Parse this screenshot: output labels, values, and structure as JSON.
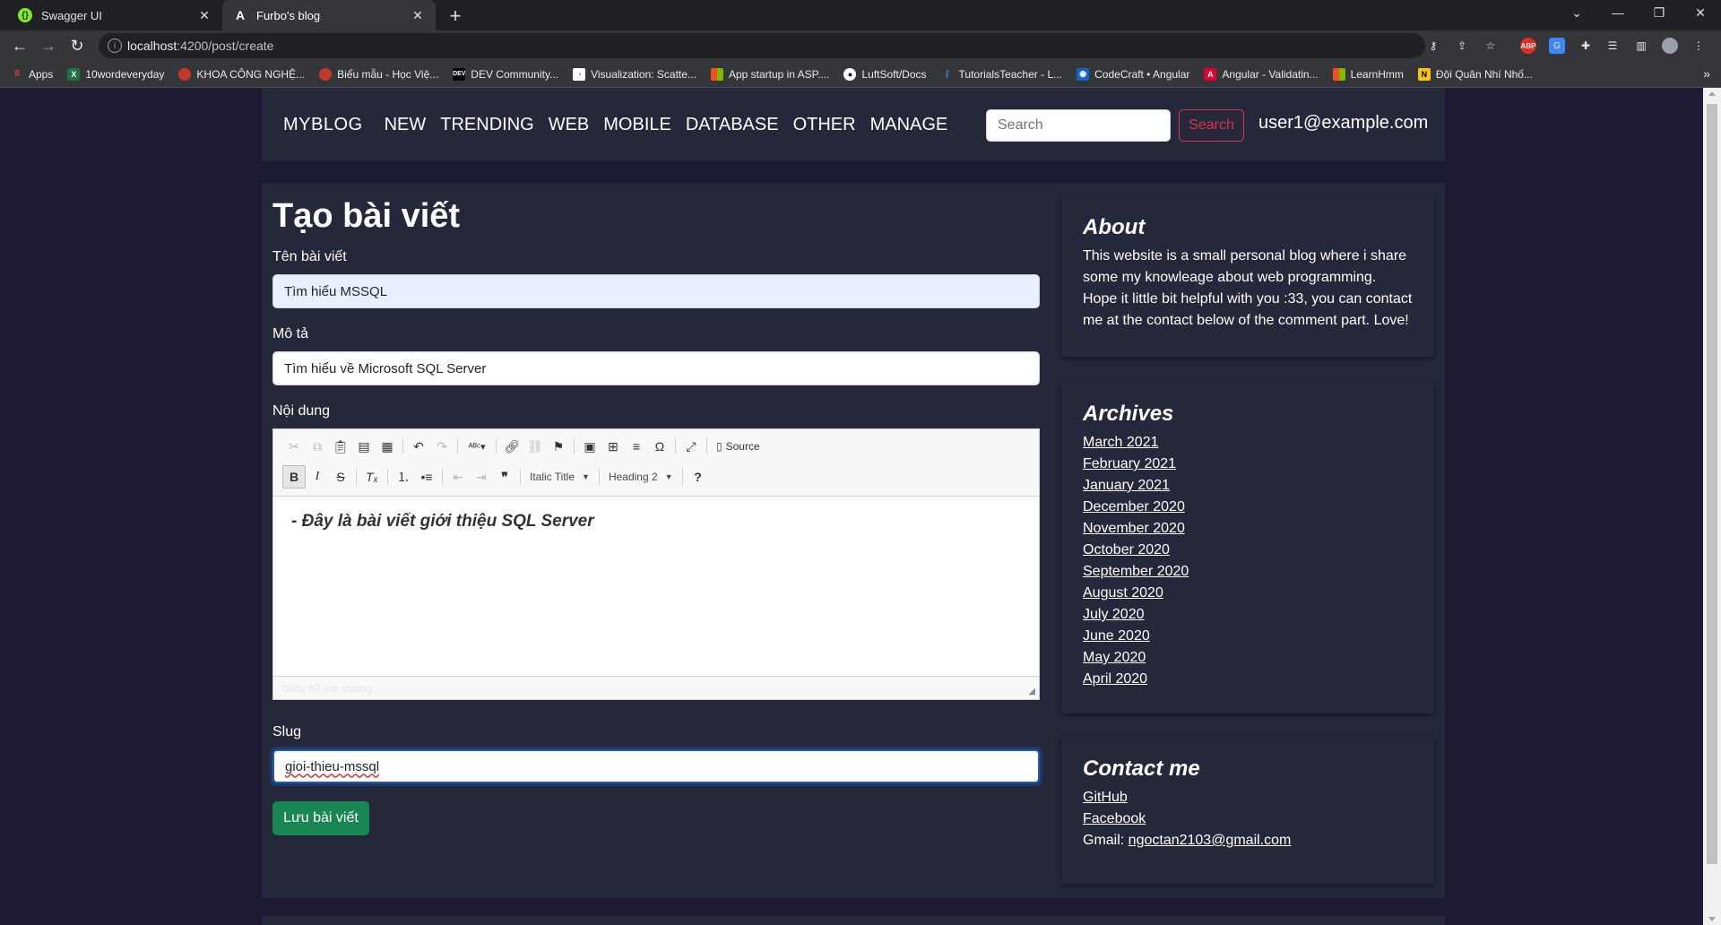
{
  "browser": {
    "tabs": [
      {
        "title": "Swagger UI",
        "favicon": "swagger-icon",
        "active": false
      },
      {
        "title": "Furbo's blog",
        "favicon": "angular-icon",
        "active": true
      }
    ],
    "url_host": "localhost",
    "url_rest": ":4200/post/create",
    "bookmarks": [
      {
        "label": "Apps",
        "icon": "apps-grid-icon",
        "color": "#ea4335"
      },
      {
        "label": "10wordeveryday",
        "icon": "excel-icon",
        "color": "#1f7244"
      },
      {
        "label": "KHOA CÔNG NGHỆ...",
        "icon": "school-icon",
        "color": "#c0392b"
      },
      {
        "label": "Biểu mẫu - Học Việ...",
        "icon": "school-icon",
        "color": "#c0392b"
      },
      {
        "label": "DEV Community...",
        "icon": "dev-icon",
        "color": "#000000"
      },
      {
        "label": "Visualization: Scatte...",
        "icon": "google-charts-icon",
        "color": "#4285f4"
      },
      {
        "label": "App startup in ASP....",
        "icon": "microsoft-icon",
        "color": "#f25022"
      },
      {
        "label": "LuftSoft/Docs",
        "icon": "github-icon",
        "color": "#ffffff"
      },
      {
        "label": "TutorialsTeacher - L...",
        "icon": "tutorialsteacher-icon",
        "color": "#1e88e5"
      },
      {
        "label": "CodeCraft • Angular",
        "icon": "codecraft-icon",
        "color": "#1565c0"
      },
      {
        "label": "Angular - Validatin...",
        "icon": "angular-icon",
        "color": "#dd0031"
      },
      {
        "label": "LearnHmm",
        "icon": "microsoft-icon",
        "color": "#f25022"
      },
      {
        "label": "Đội Quân Nhí Nhố...",
        "icon": "n-icon",
        "color": "#f5c518"
      }
    ]
  },
  "site": {
    "brand": "MYBLOG",
    "nav": [
      "NEW",
      "TRENDING",
      "WEB",
      "MOBILE",
      "DATABASE",
      "OTHER",
      "MANAGE"
    ],
    "search_placeholder": "Search",
    "search_button": "Search",
    "user": "user1@example.com"
  },
  "form": {
    "title": "Tạo bài viết",
    "name_label": "Tên bài viết",
    "name_value": "Tìm hiểu MSSQL",
    "desc_label": "Mô tả",
    "desc_value": "Tìm hiểu về Microsoft SQL Server",
    "content_label": "Nội dung",
    "editor": {
      "source_label": "Source",
      "style_combo": "Italic Title",
      "format_combo": "Heading 2",
      "content": "- Đây là bài viết giới thiệu SQL Server",
      "path": "body  h2  em  strong"
    },
    "slug_label": "Slug",
    "slug_value": "gioi-thieu-mssql",
    "save_button": "Lưu bài viết"
  },
  "sidebar": {
    "about": {
      "title": "About",
      "text": "This website is a small personal blog where i share some my knowleage about web programming. Hope it little bit helpful with you :33, you can contact me at the contact below of the comment part. Love!"
    },
    "archives": {
      "title": "Archives",
      "items": [
        "March 2021",
        "February 2021",
        "January 2021",
        "December 2020",
        "November 2020",
        "October 2020",
        "September 2020",
        "August 2020",
        "July 2020",
        "June 2020",
        "May 2020",
        "April 2020"
      ]
    },
    "contact": {
      "title": "Contact me",
      "github": "GitHub",
      "facebook": "Facebook",
      "gmail_label": "Gmail: ",
      "gmail": "ngoctan2103@gmail.com"
    }
  },
  "colors": {
    "page_bg": "#1d1a33",
    "panel_bg": "#25283a",
    "success": "#198754",
    "danger": "#dc3545"
  }
}
